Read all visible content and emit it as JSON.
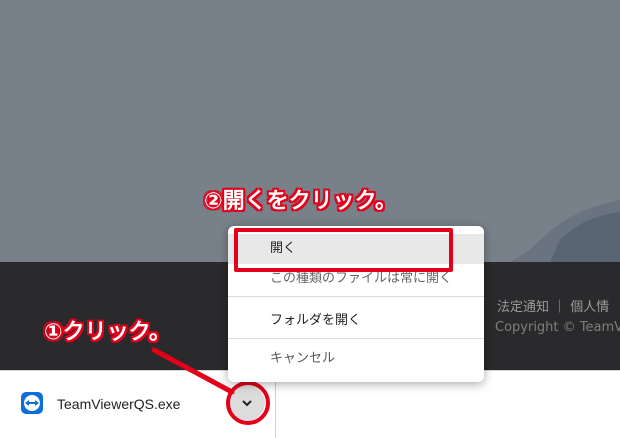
{
  "annotations": {
    "step2": "②開くをクリック。",
    "step1": "①クリック。"
  },
  "footer": {
    "links": "法定通知 ｜ 個人情",
    "copyright": "Copyright © TeamV"
  },
  "download": {
    "filename": "TeamViewerQS.exe",
    "icon": "teamviewer-icon",
    "menu_button_icon": "chevron-down-icon"
  },
  "menu": {
    "open": "開く",
    "always_open": "この種類のファイルは常に開く",
    "show_in_folder": "フォルダを開く",
    "cancel": "キャンセル"
  },
  "colors": {
    "annotation_red": "#e2001a",
    "page_bg": "#78808a",
    "footer_bg": "#2a2a2c"
  }
}
